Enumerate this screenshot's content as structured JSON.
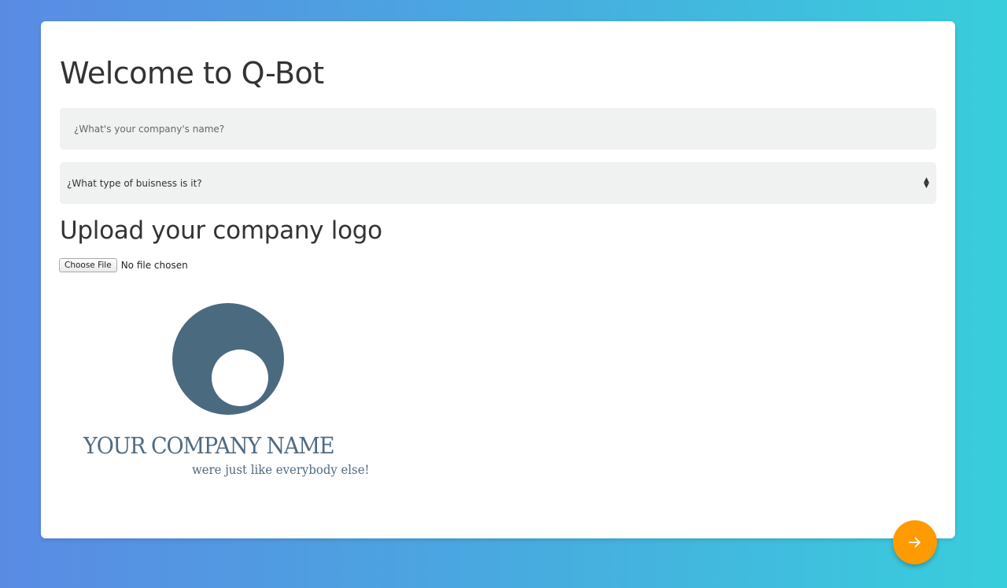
{
  "page": {
    "title": "Welcome to Q-Bot"
  },
  "form": {
    "company_name": {
      "value": "",
      "placeholder": "¿What's your company's name?"
    },
    "business_type": {
      "selected": "¿What type of buisness is it?"
    },
    "logo_upload": {
      "heading": "Upload your company logo",
      "button_label": "Choose File",
      "status": "No file chosen"
    }
  },
  "logo_preview": {
    "company_name": "YOUR COMPANY NAME",
    "slogan": "were just like everybody else!",
    "color": "#4f6b82"
  },
  "actions": {
    "next_icon": "arrow-right-icon",
    "next_color": "#ff9a00"
  },
  "theme": {
    "gradient_start": "#5a8be4",
    "gradient_end": "#38cedc",
    "field_background": "#f0f1f1"
  }
}
